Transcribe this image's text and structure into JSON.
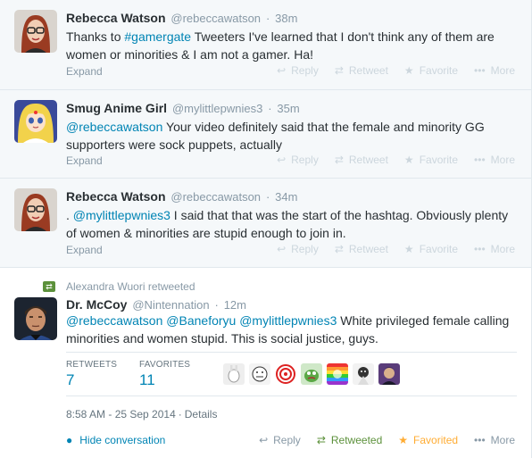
{
  "tweets": [
    {
      "fullname": "Rebecca Watson",
      "username": "@rebeccawatson",
      "time": "38m",
      "text_parts": [
        "Thanks to ",
        "#gamergate",
        " Tweeters I've learned that I don't think any of them are women or minorities & I am not a gamer. Ha!"
      ],
      "expand": "Expand"
    },
    {
      "fullname": "Smug Anime Girl",
      "username": "@mylittlepwnies3",
      "time": "35m",
      "text_parts": [
        "@rebeccawatson",
        " Your video definitely said that the female and minority GG supporters were sock puppets, actually"
      ],
      "expand": "Expand"
    },
    {
      "fullname": "Rebecca Watson",
      "username": "@rebeccawatson",
      "time": "34m",
      "text_parts": [
        ". ",
        "@mylittlepwnies3",
        " I said that that was the start of the hashtag. Obviously plenty of women & minorities are stupid enough to join in."
      ],
      "expand": "Expand"
    },
    {
      "retweet_context": "Alexandra Wuori retweeted",
      "fullname": "Dr. McCoy",
      "username": "@Nintennation",
      "time": "12m",
      "text_parts": [
        "@rebeccawatson",
        " ",
        "@Baneforyu",
        " ",
        "@mylittlepwnies3",
        " White privileged female calling minorities and women stupid. This is social justice, guys."
      ],
      "retweets_label": "RETWEETS",
      "retweets_count": "7",
      "favorites_label": "FAVORITES",
      "favorites_count": "11",
      "timestamp": "8:58 AM - 25 Sep 2014",
      "separator": "·",
      "details": "Details",
      "hide_conversation": "Hide conversation"
    }
  ],
  "actions": {
    "reply": "Reply",
    "retweet": "Retweet",
    "retweeted": "Retweeted",
    "favorite": "Favorite",
    "favorited": "Favorited",
    "more": "More"
  },
  "separator_dot": "·",
  "icons": {
    "reply": "reply-icon",
    "retweet": "retweet-icon",
    "favorite": "star-icon",
    "more": "more-dots-icon",
    "conversation": "speech-bubble-icon"
  },
  "colors": {
    "link": "#0084b4",
    "retweet_green": "#5c913b",
    "favorite_orange": "#ffac33",
    "muted": "#8899a6",
    "background_alt": "#f5f8fa"
  }
}
